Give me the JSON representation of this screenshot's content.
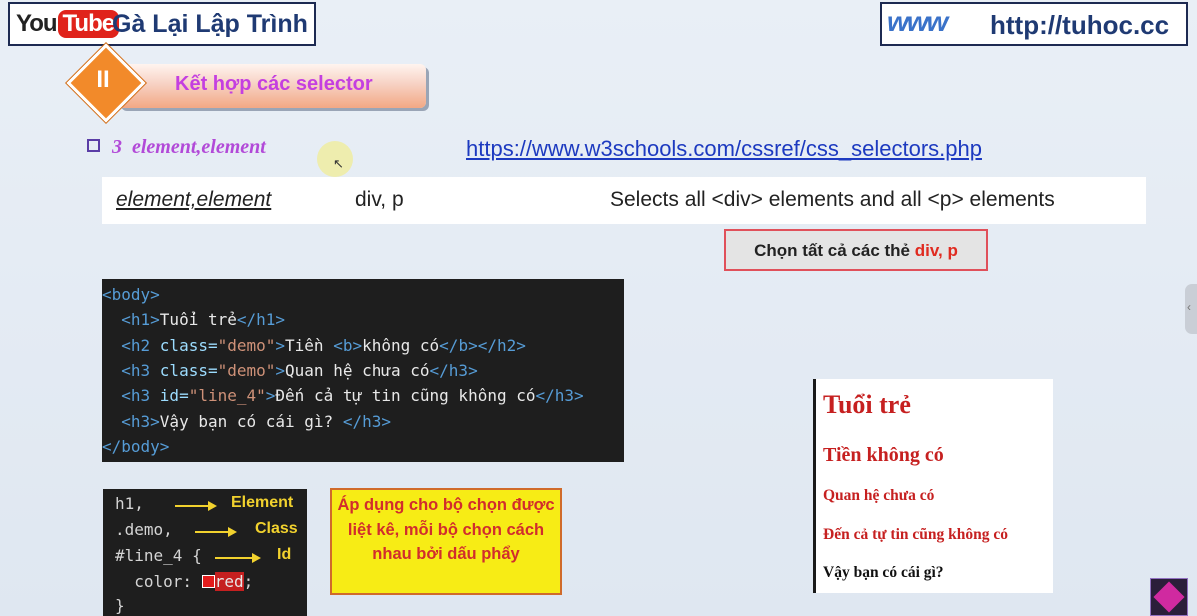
{
  "header": {
    "yt_you": "You",
    "yt_tube": "Tube",
    "channel": "Gà Lại Lập Trình",
    "www": "www",
    "site": "http://tuhoc.cc"
  },
  "banner": {
    "numeral": "II",
    "title": "Kết hợp các selector"
  },
  "bullet": {
    "text": "3  element,element",
    "link": "https://www.w3schools.com/cssref/css_selectors.php"
  },
  "selector_row": {
    "name": "element,element",
    "example": "div, p",
    "description": "Selects all <div> elements and all <p> elements"
  },
  "note": {
    "prefix": "Chọn tất cả các thẻ ",
    "highlight": "div, p"
  },
  "code_lines": [
    [
      {
        "t": "<body>",
        "c": "tg"
      }
    ],
    [
      {
        "t": "  <h1>",
        "c": "tg"
      },
      {
        "t": "Tuổi trẻ",
        "c": "tx"
      },
      {
        "t": "</h1>",
        "c": "tg"
      }
    ],
    [
      {
        "t": "  <h2 ",
        "c": "tg"
      },
      {
        "t": "class=",
        "c": "at"
      },
      {
        "t": "\"demo\"",
        "c": "st"
      },
      {
        "t": ">",
        "c": "tg"
      },
      {
        "t": "Tiền ",
        "c": "tx"
      },
      {
        "t": "<b>",
        "c": "tg"
      },
      {
        "t": "không có",
        "c": "tx"
      },
      {
        "t": "</b></h2>",
        "c": "tg"
      }
    ],
    [
      {
        "t": "  <h3 ",
        "c": "tg"
      },
      {
        "t": "class=",
        "c": "at"
      },
      {
        "t": "\"demo\"",
        "c": "st"
      },
      {
        "t": ">",
        "c": "tg"
      },
      {
        "t": "Quan hệ chưa có",
        "c": "tx"
      },
      {
        "t": "</h3>",
        "c": "tg"
      }
    ],
    [
      {
        "t": "  <h3 ",
        "c": "tg"
      },
      {
        "t": "id=",
        "c": "at"
      },
      {
        "t": "\"line_4\"",
        "c": "st"
      },
      {
        "t": ">",
        "c": "tg"
      },
      {
        "t": "Đến cả tự tin cũng không có",
        "c": "tx"
      },
      {
        "t": "</h3>",
        "c": "tg"
      }
    ],
    [
      {
        "t": "  <h3>",
        "c": "tg"
      },
      {
        "t": "Vậy bạn có cái gì? ",
        "c": "tx"
      },
      {
        "t": "</h3>",
        "c": "tg"
      }
    ],
    [
      {
        "t": "</body>",
        "c": "tg"
      }
    ]
  ],
  "css_snippet": {
    "line1": "h1,",
    "line2": ".demo,",
    "line3": "#line_4 {",
    "prop": "  color: ",
    "value": "red",
    "end": ";",
    "close": "}",
    "label_element": "Element",
    "label_class": "Class",
    "label_id": "Id"
  },
  "yellow_note": "Áp dụng cho bộ chọn được liệt kê, mỗi bộ chọn cách nhau bởi dấu phẩy",
  "preview": {
    "h1": "Tuổi trẻ",
    "h2": "Tiền không có",
    "h3a": "Quan hệ chưa có",
    "h3b": "Đến cả tự tin cũng không có",
    "h3c": "Vậy bạn có cái gì?"
  },
  "colors": {
    "accent_orange": "#f28a2a",
    "banner_text": "#c43fe0",
    "preview_red": "#c62020",
    "note_red": "#e02b20"
  }
}
